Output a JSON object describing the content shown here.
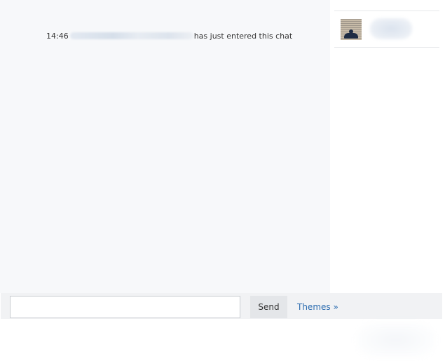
{
  "chat_log": {
    "messages": [
      {
        "time": "14:46",
        "user": "",
        "text": "has just entered this chat"
      }
    ]
  },
  "user_list": {
    "users": [
      {
        "name": ""
      }
    ]
  },
  "composer": {
    "input_value": "",
    "input_placeholder": "",
    "send_label": "Send",
    "themes_label": "Themes »"
  }
}
